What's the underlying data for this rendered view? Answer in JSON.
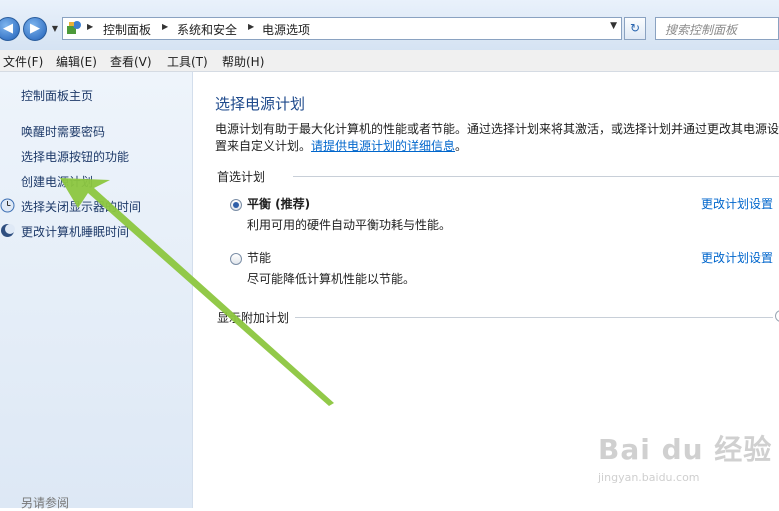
{
  "address_bar": {
    "breadcrumbs": [
      "控制面板",
      "系统和安全",
      "电源选项"
    ],
    "search_placeholder": "搜索控制面板",
    "back_icon": "back-arrow-icon",
    "forward_icon": "forward-arrow-icon",
    "refresh_icon": "refresh-icon"
  },
  "menu": {
    "file": "文件(F)",
    "edit": "编辑(E)",
    "view": "查看(V)",
    "tools": "工具(T)",
    "help": "帮助(H)"
  },
  "sidebar": {
    "home": "控制面板主页",
    "links": [
      "唤醒时需要密码",
      "选择电源按钮的功能",
      "创建电源计划",
      "选择关闭显示器的时间",
      "更改计算机睡眠时间"
    ],
    "see_also": "另请参阅"
  },
  "main": {
    "title": "选择电源计划",
    "description": "电源计划有助于最大化计算机的性能或者节能。通过选择计划来将其激活，或选择计划并通过更改其电源设置来自定义计划。",
    "description_link": "请提供电源计划的详细信息",
    "description_end": "。",
    "preferred_label": "首选计划",
    "plans": [
      {
        "name": "平衡 (推荐)",
        "desc": "利用可用的硬件自动平衡功耗与性能。",
        "selected": true,
        "link": "更改计划设置"
      },
      {
        "name": "节能",
        "desc": "尽可能降低计算机性能以节能。",
        "selected": false,
        "link": "更改计划设置"
      }
    ],
    "additional_label": "显示附加计划"
  },
  "watermark": {
    "main": "Bai du 经验",
    "sub": "jingyan.baidu.com"
  },
  "colors": {
    "arrow": "#8cc63f",
    "link": "#0066cc",
    "title": "#1e4a8c"
  }
}
